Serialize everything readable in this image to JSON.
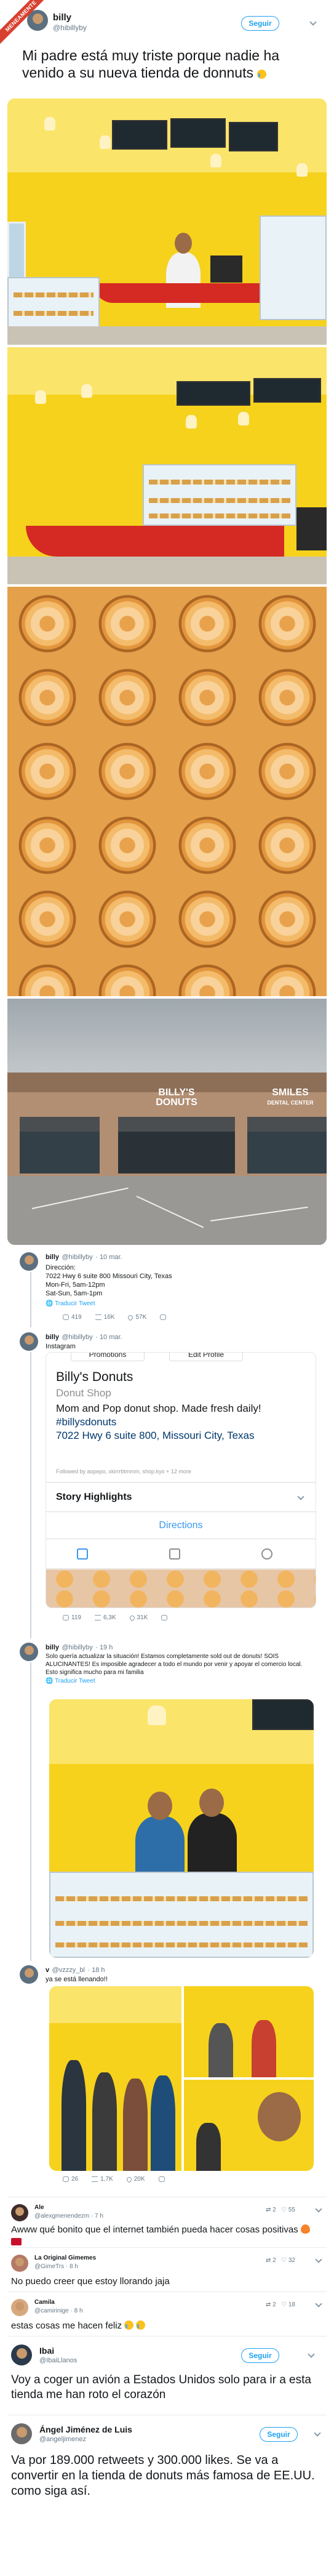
{
  "badge": "MENEAMENTE",
  "main_tweet": {
    "name": "billy",
    "handle": "@hibillyby",
    "follow": "Seguir",
    "text": "Mi padre está muy triste porque nadie ha venido a su nueva tienda de donnuts"
  },
  "store_sign": {
    "left": "BILLY'S DONUTS",
    "right": "SMILES",
    "right_sub": "DENTAL CENTER"
  },
  "reply1": {
    "name": "billy",
    "handle": "@hibillyby",
    "time": "· 10 mar.",
    "lines": [
      "Dirección:",
      "7022 Hwy 6 suite 800 Missouri City, Texas",
      "Mon-Fri, 5am-12pm",
      "Sat-Sun, 5am-1pm"
    ],
    "translate": "Traducir Tweet",
    "stats": {
      "replies": "419",
      "retweets": "16K",
      "likes": "57K"
    }
  },
  "reply2": {
    "name": "billy",
    "handle": "@hibillyby",
    "time": "· 10 mar.",
    "text": "Instagram",
    "ig": {
      "top_left": "Promotions",
      "top_right": "Edit Profile",
      "title": "Billy's Donuts",
      "category": "Donut Shop",
      "bio": "Mom and Pop donut shop. Made fresh daily!",
      "hashtag": "#billysdonuts",
      "address": "7022 Hwy 6 suite 800, Missouri City, Texas",
      "followed_by": "Followed by aopepo, xkirrrbtmmm, shop.kyo + 12 more",
      "highlights": "Story Highlights",
      "directions": "Directions"
    },
    "stats": {
      "replies": "119",
      "retweets": "6,3K",
      "likes": "31K"
    }
  },
  "reply3": {
    "name": "billy",
    "handle": "@hibillyby",
    "time": "· 19 h",
    "text": "Solo quería actualizar la situación! Estamos completamente sold out de donuts! SOIS ALUCINANTES! Es imposible agradecer a todo el mundo por venir y apoyar el comercio local. Esto significa mucho para mi familia",
    "translate": "Traducir Tweet"
  },
  "reply4": {
    "name": "v",
    "handle": "@vzzzy_bl",
    "time": "· 18 h",
    "text": "ya se está llenando!!",
    "stats": {
      "replies": "26",
      "retweets": "1,7K",
      "likes": "20K"
    }
  },
  "comments": [
    {
      "name": "Ale",
      "handle": "@alexgmenendezm",
      "time": "· 7 h",
      "text": "Awww qué bonito que el internet también pueda hacer cosas positivas",
      "retweets": "2",
      "likes": "55"
    },
    {
      "name": "La Original Gimemes",
      "handle": "@GimeTrs",
      "time": "· 8 h",
      "text": "No puedo creer que estoy llorando jaja",
      "retweets": "2",
      "likes": "32"
    },
    {
      "name": "Camila",
      "handle": "@camirinige",
      "time": "· 8 h",
      "text": "estas cosas me hacen feliz",
      "retweets": "2",
      "likes": "18"
    }
  ],
  "tweet_ibai": {
    "name": "Ibai",
    "handle": "@IbaiLlanos",
    "follow": "Seguir",
    "text": "Voy a coger un avión a Estados Unidos solo para ir a esta tienda me han roto el corazón"
  },
  "tweet_angel": {
    "name": "Ángel Jiménez de Luis",
    "handle": "@angeljimenez",
    "follow": "Seguir",
    "text": "Va por 189.000 retweets y 300.000 likes. Se va a convertir en la tienda de donuts más famosa de EE.UU. como siga así."
  }
}
